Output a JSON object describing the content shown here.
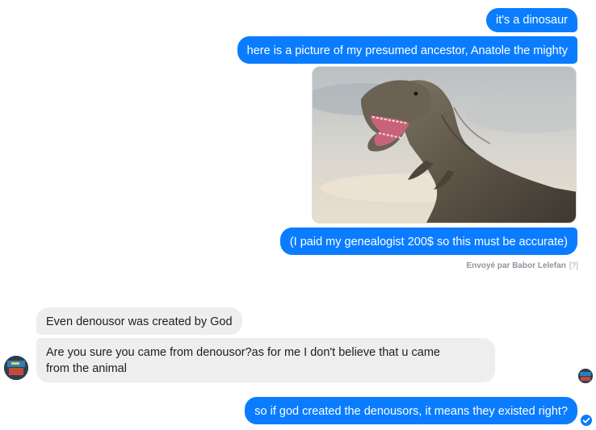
{
  "conversation": {
    "outgoing": [
      {
        "text": "it's a dinosaur"
      },
      {
        "text": "here is a picture of my presumed ancestor, Anatole the mighty"
      },
      {
        "image": "t-rex-dinosaur-photo"
      },
      {
        "text": "(I paid my genealogist 200$ so this must be accurate)"
      }
    ],
    "sent_by": "Envoyé par Babor Lelefan",
    "help_marker": "[?]",
    "incoming": [
      {
        "text": "Even denousor was created by God"
      },
      {
        "line1": "Are you sure you came from denousor?as for me I don't believe that u came",
        "line2": "from the animal"
      }
    ],
    "reply": {
      "text": "so if god created the denousors, it means they existed right?"
    }
  },
  "colors": {
    "outgoing_bubble": "#0a7cff",
    "incoming_bubble": "#eeeeee",
    "meta_text": "#90949c"
  },
  "icons": {
    "contact_avatar": "avatar",
    "seen_avatar": "seen-avatar",
    "delivered": "check-circle-icon"
  }
}
